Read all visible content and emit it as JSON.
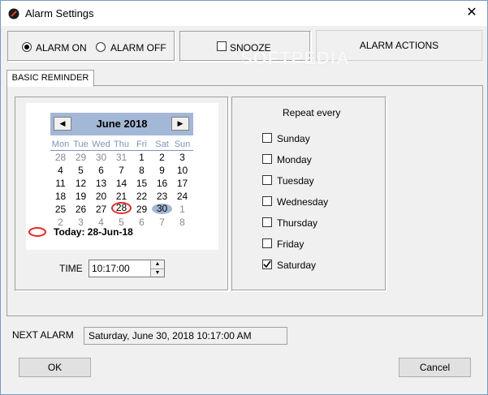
{
  "window": {
    "title": "Alarm Settings",
    "close_glyph": "✕"
  },
  "alarm_toggle": {
    "on_label": "ALARM ON",
    "off_label": "ALARM OFF",
    "selected": "on"
  },
  "snooze": {
    "label": "SNOOZE",
    "checked": false
  },
  "alarm_actions_label": "ALARM ACTIONS",
  "watermark": "SOFTPEDIA",
  "tabs": [
    {
      "label": "BASIC REMINDER",
      "active": true
    }
  ],
  "calendar": {
    "month_title": "June 2018",
    "prev_glyph": "◀",
    "next_glyph": "▶",
    "weekdays": [
      "Mon",
      "Tue",
      "Wed",
      "Thu",
      "Fri",
      "Sat",
      "Sun"
    ],
    "weeks": [
      [
        {
          "d": "28",
          "g": true
        },
        {
          "d": "29",
          "g": true
        },
        {
          "d": "30",
          "g": true
        },
        {
          "d": "31",
          "g": true
        },
        {
          "d": "1"
        },
        {
          "d": "2"
        },
        {
          "d": "3"
        }
      ],
      [
        {
          "d": "4"
        },
        {
          "d": "5"
        },
        {
          "d": "6"
        },
        {
          "d": "7"
        },
        {
          "d": "8"
        },
        {
          "d": "9"
        },
        {
          "d": "10"
        }
      ],
      [
        {
          "d": "11"
        },
        {
          "d": "12"
        },
        {
          "d": "13"
        },
        {
          "d": "14"
        },
        {
          "d": "15"
        },
        {
          "d": "16"
        },
        {
          "d": "17"
        }
      ],
      [
        {
          "d": "18"
        },
        {
          "d": "19"
        },
        {
          "d": "20"
        },
        {
          "d": "21"
        },
        {
          "d": "22"
        },
        {
          "d": "23"
        },
        {
          "d": "24"
        }
      ],
      [
        {
          "d": "25"
        },
        {
          "d": "26"
        },
        {
          "d": "27"
        },
        {
          "d": "28",
          "today": true
        },
        {
          "d": "29"
        },
        {
          "d": "30",
          "sel": true
        },
        {
          "d": "1",
          "g": true
        }
      ],
      [
        {
          "d": "2",
          "g": true
        },
        {
          "d": "3",
          "g": true
        },
        {
          "d": "4",
          "g": true
        },
        {
          "d": "5",
          "g": true
        },
        {
          "d": "6",
          "g": true
        },
        {
          "d": "7",
          "g": true
        },
        {
          "d": "8",
          "g": true
        }
      ]
    ],
    "today_label": "Today: 28-Jun-18",
    "accent_color": "#a3b7d6",
    "today_circle_color": "#e52a2a"
  },
  "time": {
    "label": "TIME",
    "value": "10:17:00",
    "up_glyph": "▲",
    "down_glyph": "▼"
  },
  "repeat": {
    "title": "Repeat every",
    "days": [
      {
        "label": "Sunday",
        "checked": false
      },
      {
        "label": "Monday",
        "checked": false
      },
      {
        "label": "Tuesday",
        "checked": false
      },
      {
        "label": "Wednesday",
        "checked": false
      },
      {
        "label": "Thursday",
        "checked": false
      },
      {
        "label": "Friday",
        "checked": false
      },
      {
        "label": "Saturday",
        "checked": true
      }
    ]
  },
  "next_alarm": {
    "label": "NEXT ALARM",
    "value": "Saturday, June 30, 2018 10:17:00 AM"
  },
  "buttons": {
    "ok": "OK",
    "cancel": "Cancel"
  }
}
